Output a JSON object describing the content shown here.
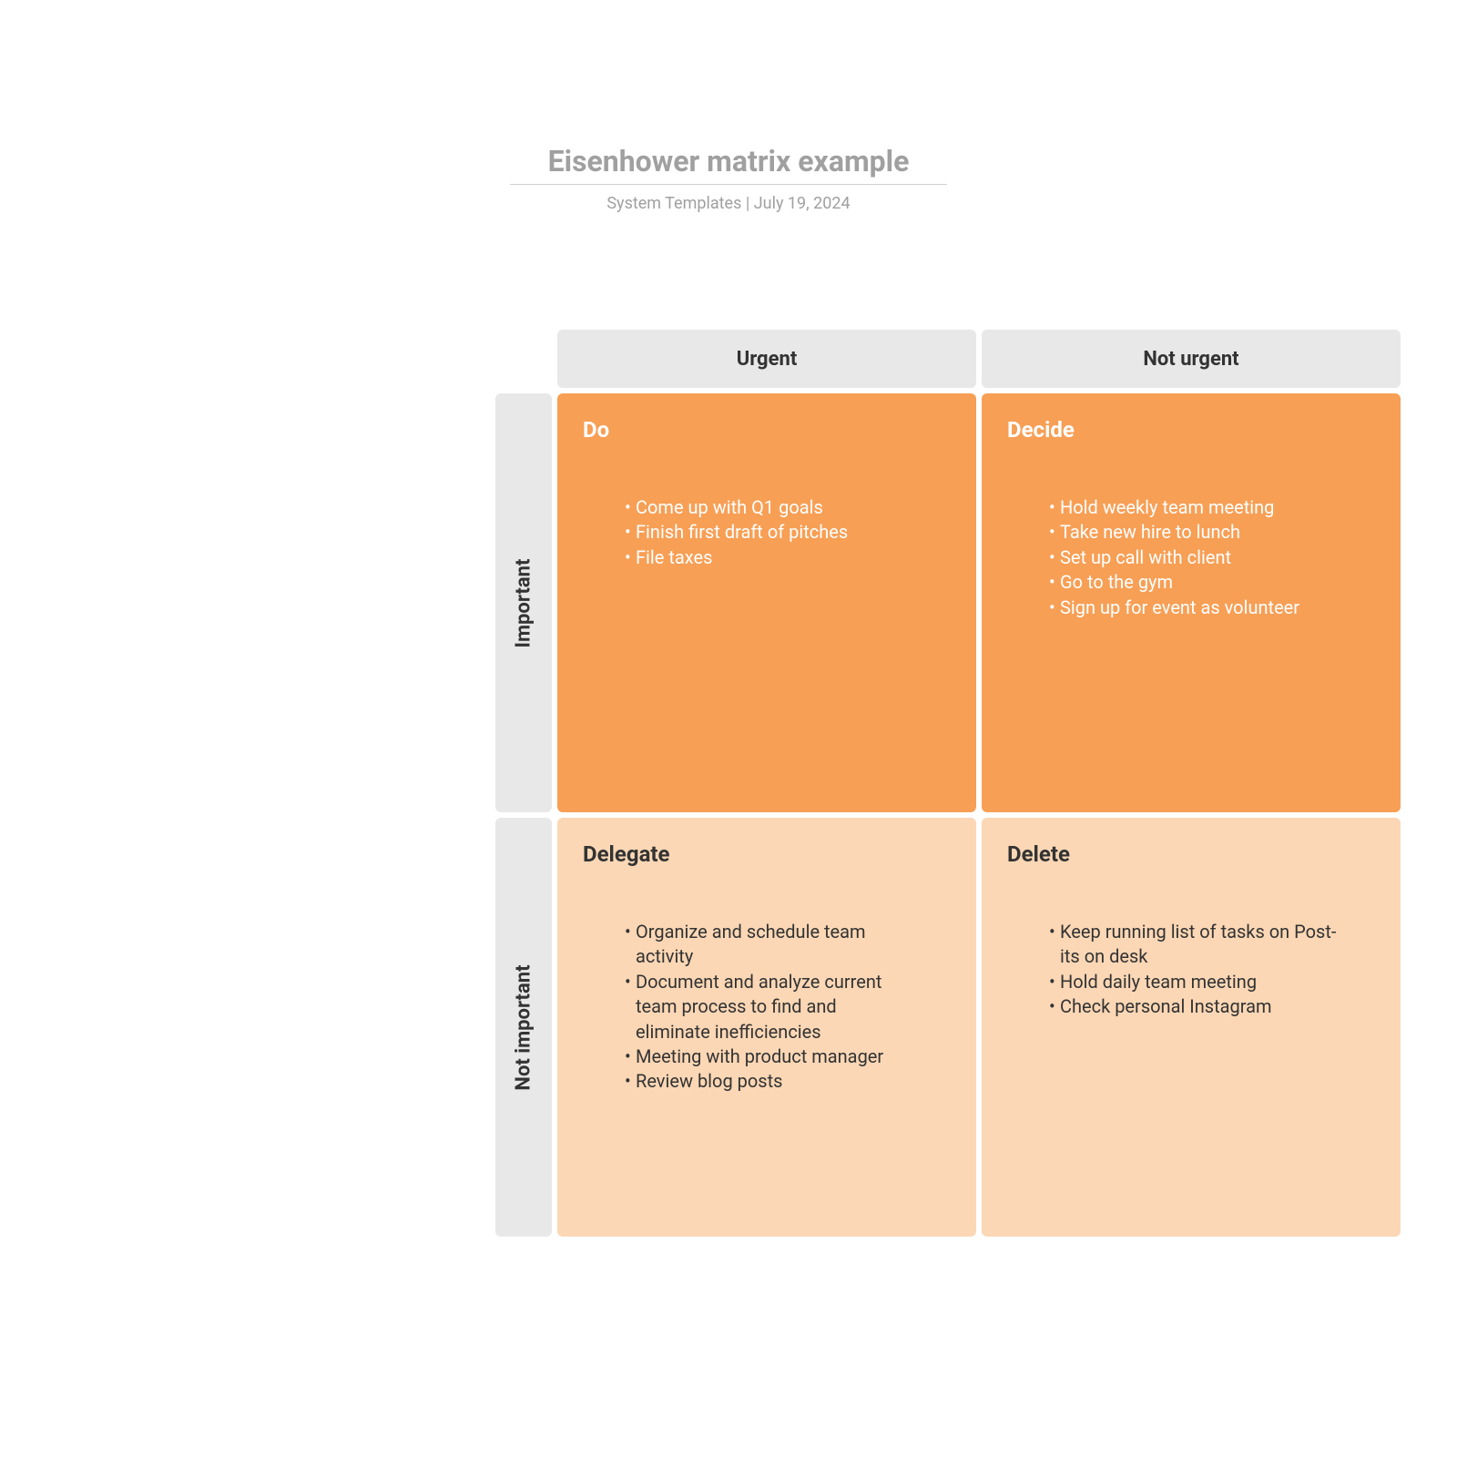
{
  "header": {
    "title": "Eisenhower matrix example",
    "subtitle_author": "System Templates",
    "subtitle_sep": "  |  ",
    "subtitle_date": "July 19, 2024"
  },
  "columns": {
    "urgent": "Urgent",
    "not_urgent": "Not urgent"
  },
  "rows": {
    "important": "Important",
    "not_important": "Not important"
  },
  "quadrants": {
    "do": {
      "title": "Do",
      "items": [
        "Come up with Q1 goals",
        "Finish first draft of pitches",
        "File taxes"
      ]
    },
    "decide": {
      "title": "Decide",
      "items": [
        "Hold weekly team meeting",
        "Take new hire to lunch",
        "Set up call with client",
        "Go to the gym",
        "Sign up for event as volunteer"
      ]
    },
    "delegate": {
      "title": "Delegate",
      "items": [
        "Organize and schedule team activity",
        "Document and analyze current team process to find and eliminate inefficiencies",
        "Meeting with product manager",
        "Review blog posts"
      ]
    },
    "delete": {
      "title": "Delete",
      "items": [
        "Keep running list of tasks on Post-its on desk",
        "Hold daily team meeting",
        "Check personal Instagram"
      ]
    }
  }
}
